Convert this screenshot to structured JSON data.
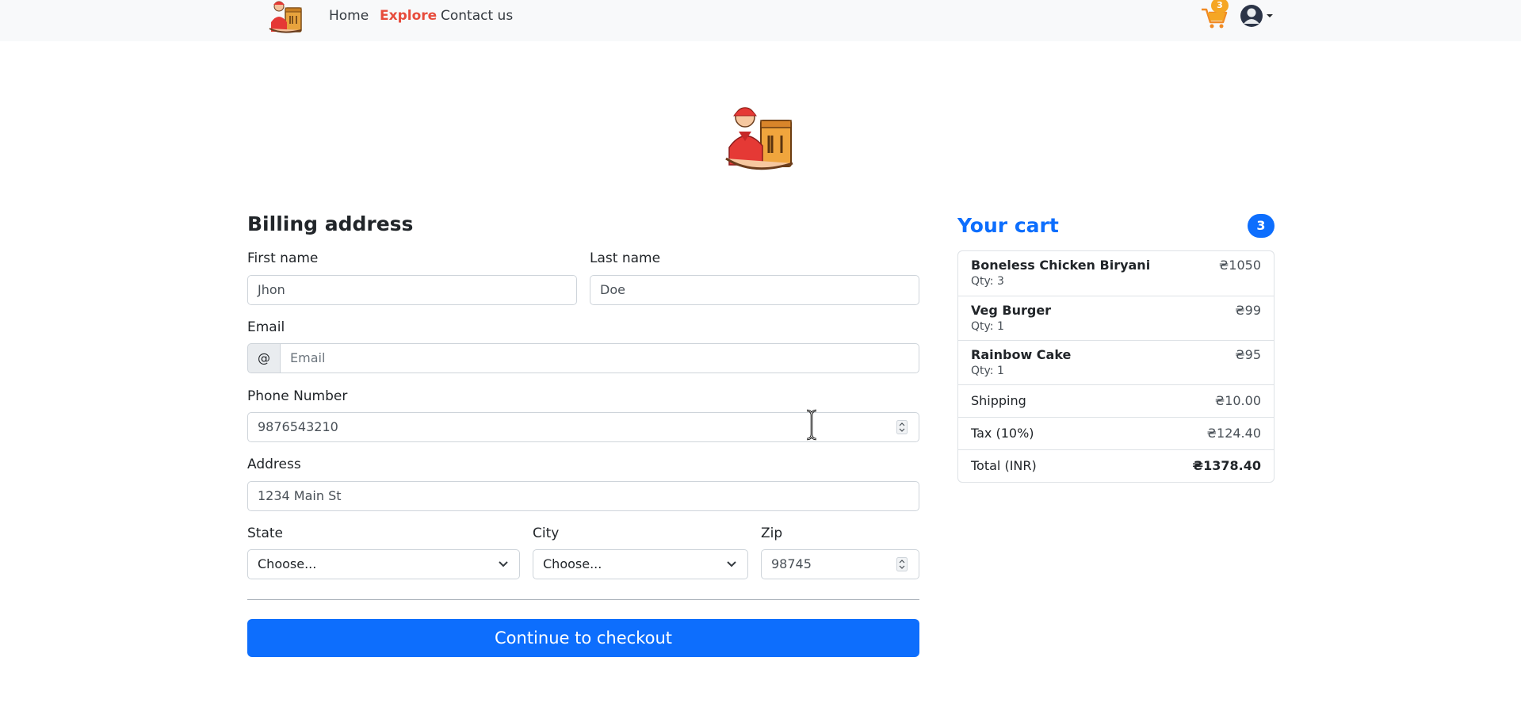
{
  "nav": {
    "links": [
      "Home",
      "Explore",
      "Contact us"
    ],
    "cart_badge": "3"
  },
  "billing": {
    "heading": "Billing address",
    "first_name": {
      "label": "First name",
      "value": "Jhon"
    },
    "last_name": {
      "label": "Last name",
      "value": "Doe"
    },
    "email": {
      "label": "Email",
      "prefix": "@",
      "placeholder": "Email"
    },
    "phone": {
      "label": "Phone Number",
      "value": "9876543210"
    },
    "address": {
      "label": "Address",
      "value": "1234 Main St"
    },
    "state": {
      "label": "State",
      "value": "Choose..."
    },
    "city": {
      "label": "City",
      "value": "Choose..."
    },
    "zip": {
      "label": "Zip",
      "value": "98745"
    },
    "checkout_label": "Continue to checkout"
  },
  "cart": {
    "title": "Your cart",
    "count": "3",
    "items": [
      {
        "name": "Boneless Chicken Biryani",
        "qty": "Qty: 3",
        "price": "₴1050"
      },
      {
        "name": "Veg Burger",
        "qty": "Qty: 1",
        "price": "₴99"
      },
      {
        "name": "Rainbow Cake",
        "qty": "Qty: 1",
        "price": "₴95"
      }
    ],
    "shipping": {
      "label": "Shipping",
      "value": "₴10.00"
    },
    "tax": {
      "label": "Tax (10%)",
      "value": "₴124.40"
    },
    "total": {
      "label": "Total (INR)",
      "value": "₴1378.40"
    }
  },
  "colors": {
    "primary": "#0d6efd",
    "explore": "#e74c3c",
    "badge": "#f5a623",
    "navbar": "#f8f9fa"
  }
}
